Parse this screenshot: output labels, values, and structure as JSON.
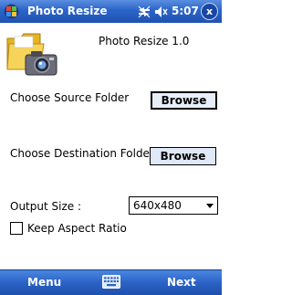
{
  "titlebar": {
    "title": "Photo Resize",
    "time": "5:07",
    "close_glyph": "x",
    "icons": [
      "windows-start-icon",
      "connectivity-icon",
      "volume-icon"
    ]
  },
  "app": {
    "title": "Photo Resize 1.0",
    "icon": "folder-camera-icon"
  },
  "source": {
    "label": "Choose Source Folder",
    "button_label": "Browse"
  },
  "destination": {
    "label": "Choose Destination Folder",
    "button_label": "Browse"
  },
  "output_size": {
    "label": "Output Size :",
    "selected": "640x480"
  },
  "aspect_ratio": {
    "label": "Keep Aspect Ratio",
    "checked": false
  },
  "softkeys": {
    "left": "Menu",
    "right": "Next",
    "center_icon": "keyboard-icon"
  },
  "colors": {
    "bar_blue": "#2b64c8",
    "button_face": "#dfe9f8"
  }
}
